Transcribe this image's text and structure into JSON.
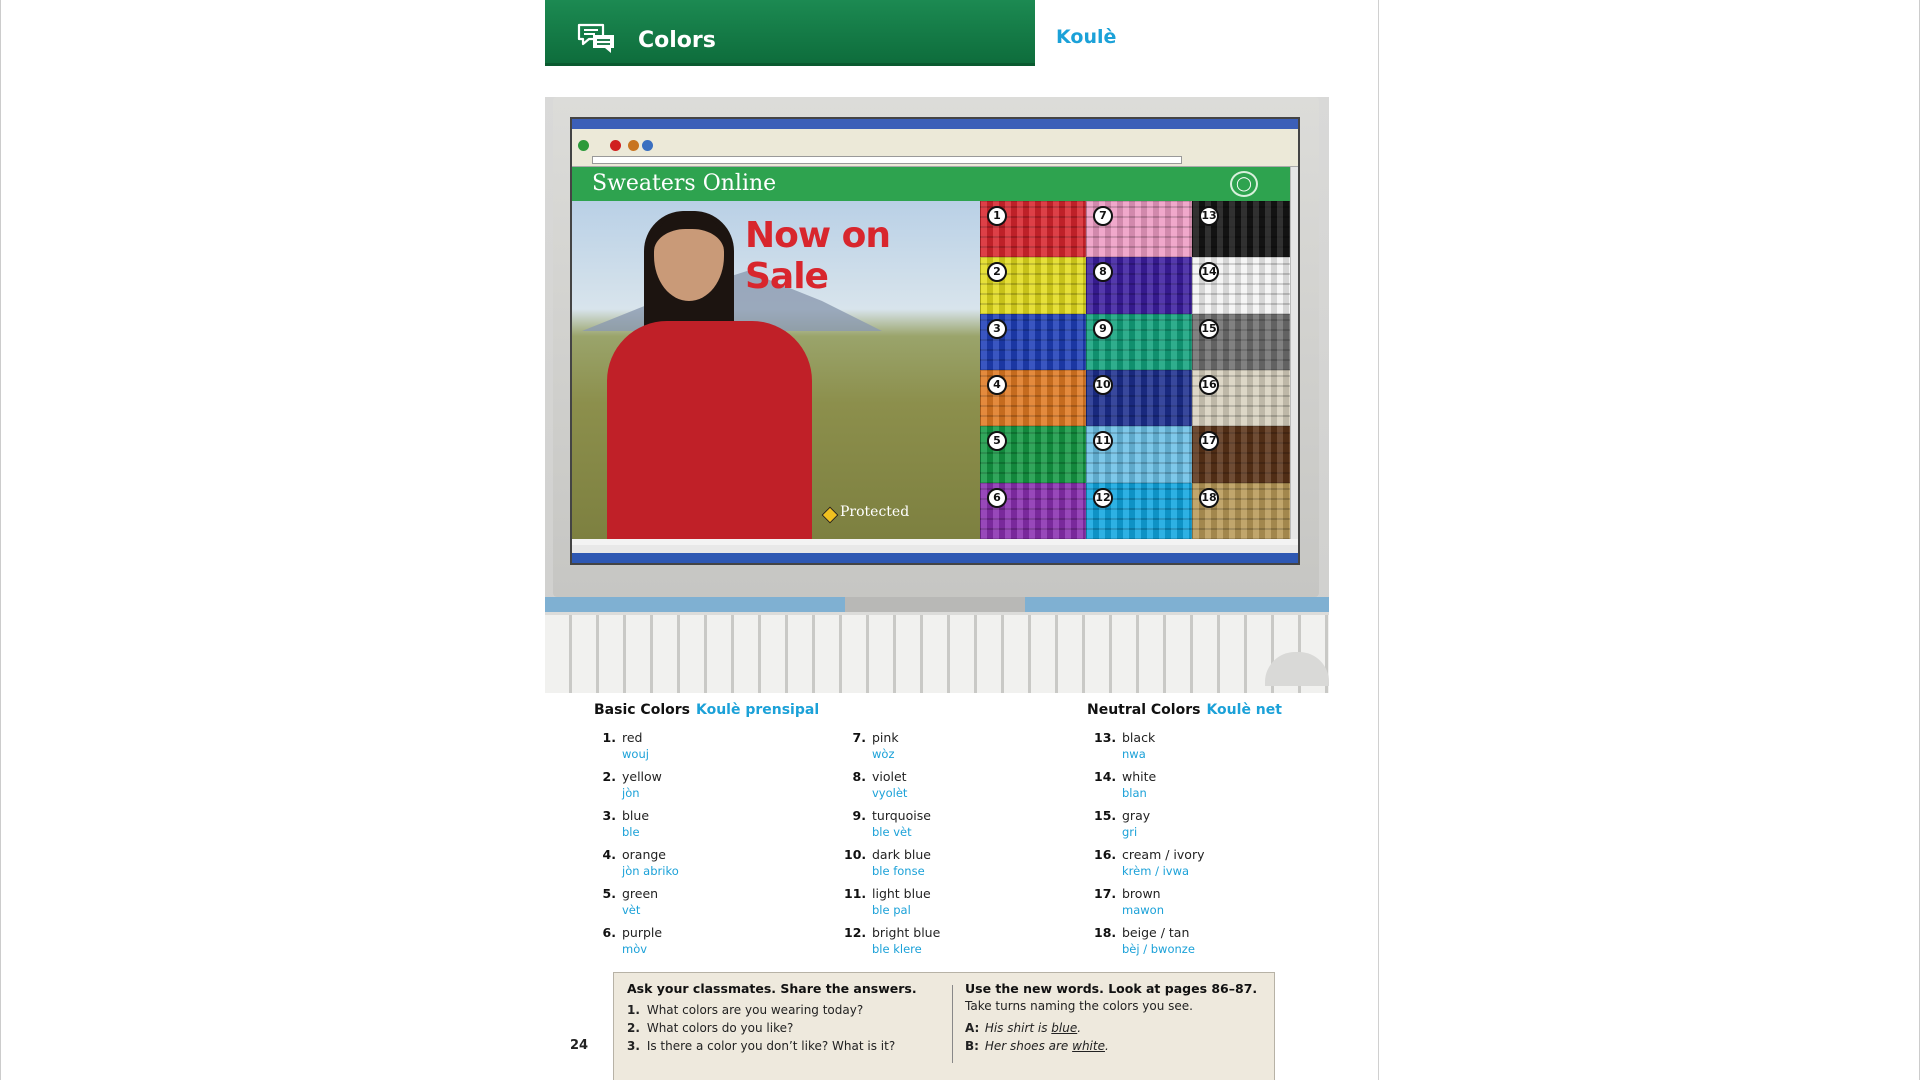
{
  "header": {
    "title": "Colors",
    "translation": "Koulè"
  },
  "photo": {
    "site_name": "Sweaters Online",
    "sale_text": "Now on Sale",
    "protected_text": "Protected",
    "swatches": [
      {
        "num": "1",
        "color": "#d8262d"
      },
      {
        "num": "2",
        "color": "#e2dc1e"
      },
      {
        "num": "3",
        "color": "#1f3fb8"
      },
      {
        "num": "4",
        "color": "#e07a22"
      },
      {
        "num": "5",
        "color": "#149a44"
      },
      {
        "num": "6",
        "color": "#8a2fb0"
      },
      {
        "num": "7",
        "color": "#ee9cc4"
      },
      {
        "num": "8",
        "color": "#3c1ea0"
      },
      {
        "num": "9",
        "color": "#12a37d"
      },
      {
        "num": "10",
        "color": "#1c2f90"
      },
      {
        "num": "11",
        "color": "#6cc0e6"
      },
      {
        "num": "12",
        "color": "#10a6e0"
      },
      {
        "num": "13",
        "color": "#141414"
      },
      {
        "num": "14",
        "color": "#f4f4f4"
      },
      {
        "num": "15",
        "color": "#707070"
      },
      {
        "num": "16",
        "color": "#d8d2bf"
      },
      {
        "num": "17",
        "color": "#5b3318"
      },
      {
        "num": "18",
        "color": "#b89a58"
      }
    ]
  },
  "basic_colors": {
    "title": "Basic Colors",
    "translation": "Koulè prensipal"
  },
  "neutral_colors": {
    "title": "Neutral Colors",
    "translation": "Koulè net"
  },
  "vocab": {
    "col1": [
      {
        "num": "1.",
        "en": "red",
        "ht": "wouj"
      },
      {
        "num": "2.",
        "en": "yellow",
        "ht": "jòn"
      },
      {
        "num": "3.",
        "en": "blue",
        "ht": "ble"
      },
      {
        "num": "4.",
        "en": "orange",
        "ht": "jòn abriko"
      },
      {
        "num": "5.",
        "en": "green",
        "ht": "vèt"
      },
      {
        "num": "6.",
        "en": "purple",
        "ht": "mòv"
      }
    ],
    "col2": [
      {
        "num": "7.",
        "en": "pink",
        "ht": "wòz"
      },
      {
        "num": "8.",
        "en": "violet",
        "ht": "vyolèt"
      },
      {
        "num": "9.",
        "en": "turquoise",
        "ht": "ble vèt"
      },
      {
        "num": "10.",
        "en": "dark blue",
        "ht": "ble fonse"
      },
      {
        "num": "11.",
        "en": "light blue",
        "ht": "ble pal"
      },
      {
        "num": "12.",
        "en": "bright blue",
        "ht": "ble klere"
      }
    ],
    "col3": [
      {
        "num": "13.",
        "en": "black",
        "ht": "nwa"
      },
      {
        "num": "14.",
        "en": "white",
        "ht": "blan"
      },
      {
        "num": "15.",
        "en": "gray",
        "ht": "gri"
      },
      {
        "num": "16.",
        "en": "cream / ivory",
        "ht": "krèm / ivwa"
      },
      {
        "num": "17.",
        "en": "brown",
        "ht": "mawon"
      },
      {
        "num": "18.",
        "en": "beige / tan",
        "ht": "bèj / bwonze"
      }
    ]
  },
  "page_number": "24",
  "activity": {
    "left_title": "Ask your classmates. Share the answers.",
    "questions": [
      {
        "num": "1.",
        "text": "What colors are you wearing today?"
      },
      {
        "num": "2.",
        "text": "What colors do you like?"
      },
      {
        "num": "3.",
        "text": "Is there a color you don’t like? What is it?"
      }
    ],
    "right_title": "Use the new words. Look at pages 86–87.",
    "right_instruction": "Take turns naming the colors you see.",
    "dialog": [
      {
        "speaker": "A:",
        "before": "His shirt is ",
        "word": "blue",
        "after": "."
      },
      {
        "speaker": "B:",
        "before": "Her shoes are ",
        "word": "white",
        "after": "."
      }
    ]
  }
}
